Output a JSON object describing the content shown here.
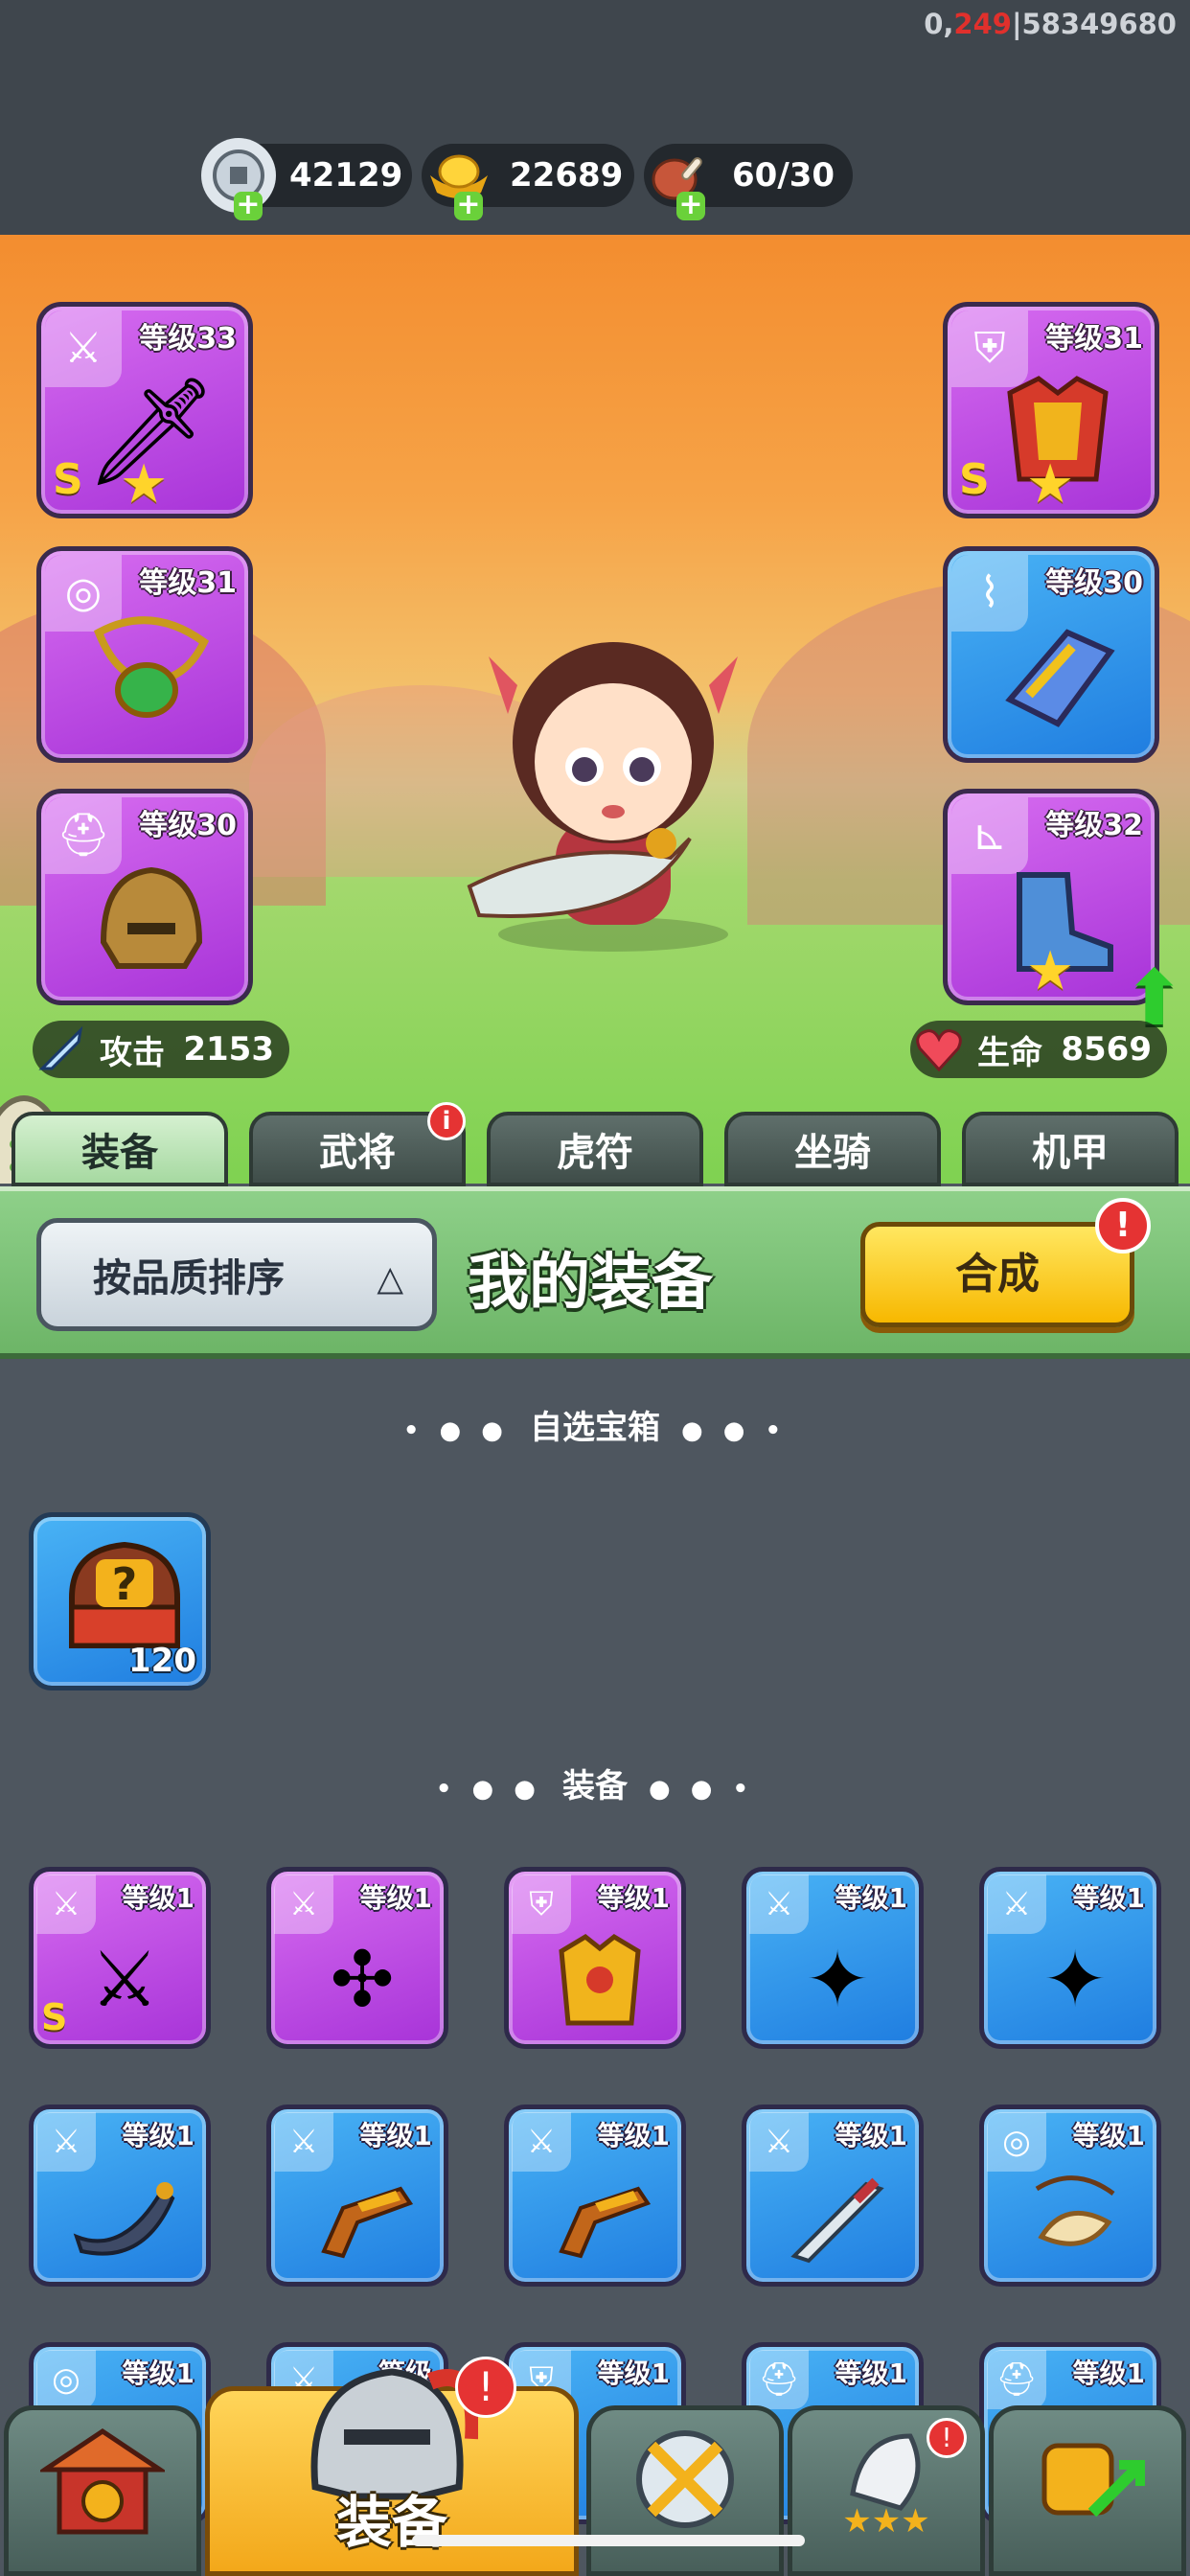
{
  "debug": {
    "prefix": "0,",
    "highlight": "249",
    "suffix": "|58349680"
  },
  "resources": [
    {
      "icon": "silver-coin-icon",
      "value": "42129"
    },
    {
      "icon": "gold-ingot-icon",
      "value": "22689"
    },
    {
      "icon": "meat-stamina-icon",
      "value": "60/30"
    }
  ],
  "hero_slots": {
    "left": [
      {
        "type": "weapon",
        "level": "等级33",
        "grade": "S",
        "star": true,
        "color": "purple"
      },
      {
        "type": "medal",
        "level": "等级31",
        "grade": "",
        "star": false,
        "color": "purple"
      },
      {
        "type": "helmet",
        "level": "等级30",
        "grade": "",
        "star": false,
        "color": "purple"
      }
    ],
    "right": [
      {
        "type": "armor",
        "level": "等级31",
        "grade": "S",
        "star": true,
        "color": "purple"
      },
      {
        "type": "bracer",
        "level": "等级30",
        "grade": "",
        "star": false,
        "color": "blue"
      },
      {
        "type": "boots",
        "level": "等级32",
        "grade": "",
        "star": true,
        "color": "purple"
      }
    ]
  },
  "stats": {
    "attack": {
      "label": "攻击",
      "value": "2153"
    },
    "hp": {
      "label": "生命",
      "value": "8569"
    }
  },
  "tabs": [
    {
      "label": "装备",
      "active": true,
      "badge": ""
    },
    {
      "label": "武将",
      "active": false,
      "badge": "i"
    },
    {
      "label": "虎符",
      "active": false,
      "badge": ""
    },
    {
      "label": "坐骑",
      "active": false,
      "badge": ""
    },
    {
      "label": "机甲",
      "active": false,
      "badge": ""
    }
  ],
  "panel": {
    "sort_label": "按品质排序",
    "title": "我的装备",
    "merge_label": "合成",
    "merge_badge": "!"
  },
  "sections": {
    "chest_title": "自选宝箱",
    "equip_title": "装备"
  },
  "chest": {
    "count": "120"
  },
  "inventory": [
    {
      "type": "weapon",
      "level": "等级1",
      "grade": "S",
      "color": "purple"
    },
    {
      "type": "weapon",
      "level": "等级1",
      "grade": "",
      "color": "purple"
    },
    {
      "type": "armor",
      "level": "等级1",
      "grade": "",
      "color": "purple"
    },
    {
      "type": "weapon",
      "level": "等级1",
      "grade": "",
      "color": "blue"
    },
    {
      "type": "weapon",
      "level": "等级1",
      "grade": "",
      "color": "blue"
    },
    {
      "type": "weapon",
      "level": "等级1",
      "grade": "",
      "color": "blue"
    },
    {
      "type": "weapon",
      "level": "等级1",
      "grade": "",
      "color": "blue"
    },
    {
      "type": "weapon",
      "level": "等级1",
      "grade": "",
      "color": "blue"
    },
    {
      "type": "weapon",
      "level": "等级1",
      "grade": "",
      "color": "blue"
    },
    {
      "type": "medal",
      "level": "等级1",
      "grade": "",
      "color": "blue"
    },
    {
      "type": "medal",
      "level": "等级1",
      "grade": "",
      "color": "blue"
    },
    {
      "type": "weapon",
      "level": "等级",
      "grade": "",
      "color": "blue"
    },
    {
      "type": "armor",
      "level": "等级1",
      "grade": "",
      "color": "blue"
    },
    {
      "type": "helmet",
      "level": "等级1",
      "grade": "",
      "color": "blue"
    },
    {
      "type": "helmet",
      "level": "等级1",
      "grade": "",
      "color": "blue"
    }
  ],
  "bottom_nav": [
    {
      "icon": "palace-gate-icon",
      "label": "",
      "active": false,
      "badge": ""
    },
    {
      "icon": "helmet-icon",
      "label": "装备",
      "active": true,
      "badge": "!"
    },
    {
      "icon": "crossed-swords-icon",
      "label": "",
      "active": false,
      "badge": ""
    },
    {
      "icon": "general-stars-icon",
      "label": "",
      "active": false,
      "badge": "!"
    },
    {
      "icon": "upgrade-fist-icon",
      "label": "",
      "active": false,
      "badge": ""
    }
  ],
  "colors": {
    "purple_rarity": "#b743e0",
    "blue_rarity": "#2a8ff0",
    "accent_yellow": "#f7c400",
    "badge_red": "#e53333"
  }
}
